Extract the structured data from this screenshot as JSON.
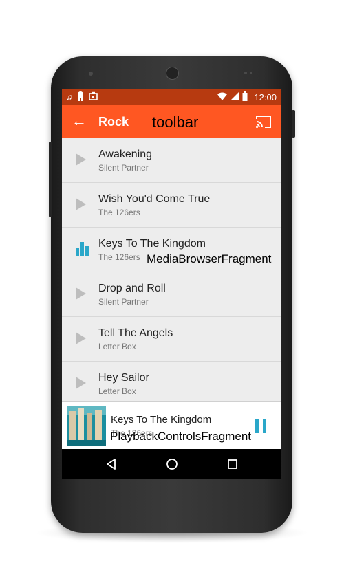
{
  "statusbar": {
    "left_icons": [
      "music-note-icon",
      "android-icon",
      "image-icon"
    ],
    "clock": "12:00",
    "right_icons": [
      "wifi-icon",
      "signal-icon",
      "battery-icon"
    ]
  },
  "toolbar": {
    "title": "Rock",
    "back_icon": "arrow-left-icon",
    "cast_icon": "cast-icon",
    "color": "#ff5722"
  },
  "annotations": {
    "toolbar": "toolbar",
    "browser": "MediaBrowserFragment",
    "controls": "PlaybackControlsFragment"
  },
  "tracks": [
    {
      "title": "Awakening",
      "artist": "Silent Partner",
      "state": "play"
    },
    {
      "title": "Wish You'd Come True",
      "artist": "The 126ers",
      "state": "play"
    },
    {
      "title": "Keys To The Kingdom",
      "artist": "The 126ers",
      "state": "playing"
    },
    {
      "title": "Drop and Roll",
      "artist": "Silent Partner",
      "state": "play"
    },
    {
      "title": "Tell The Angels",
      "artist": "Letter Box",
      "state": "play"
    },
    {
      "title": "Hey Sailor",
      "artist": "Letter Box",
      "state": "play"
    }
  ],
  "now_playing": {
    "title": "Keys To The Kingdom",
    "artist": "The 126ers",
    "control_icon": "pause-icon",
    "accent": "#2aa7c9"
  },
  "navbar": {
    "buttons": [
      "back-triangle-icon",
      "home-circle-icon",
      "recents-square-icon"
    ]
  }
}
